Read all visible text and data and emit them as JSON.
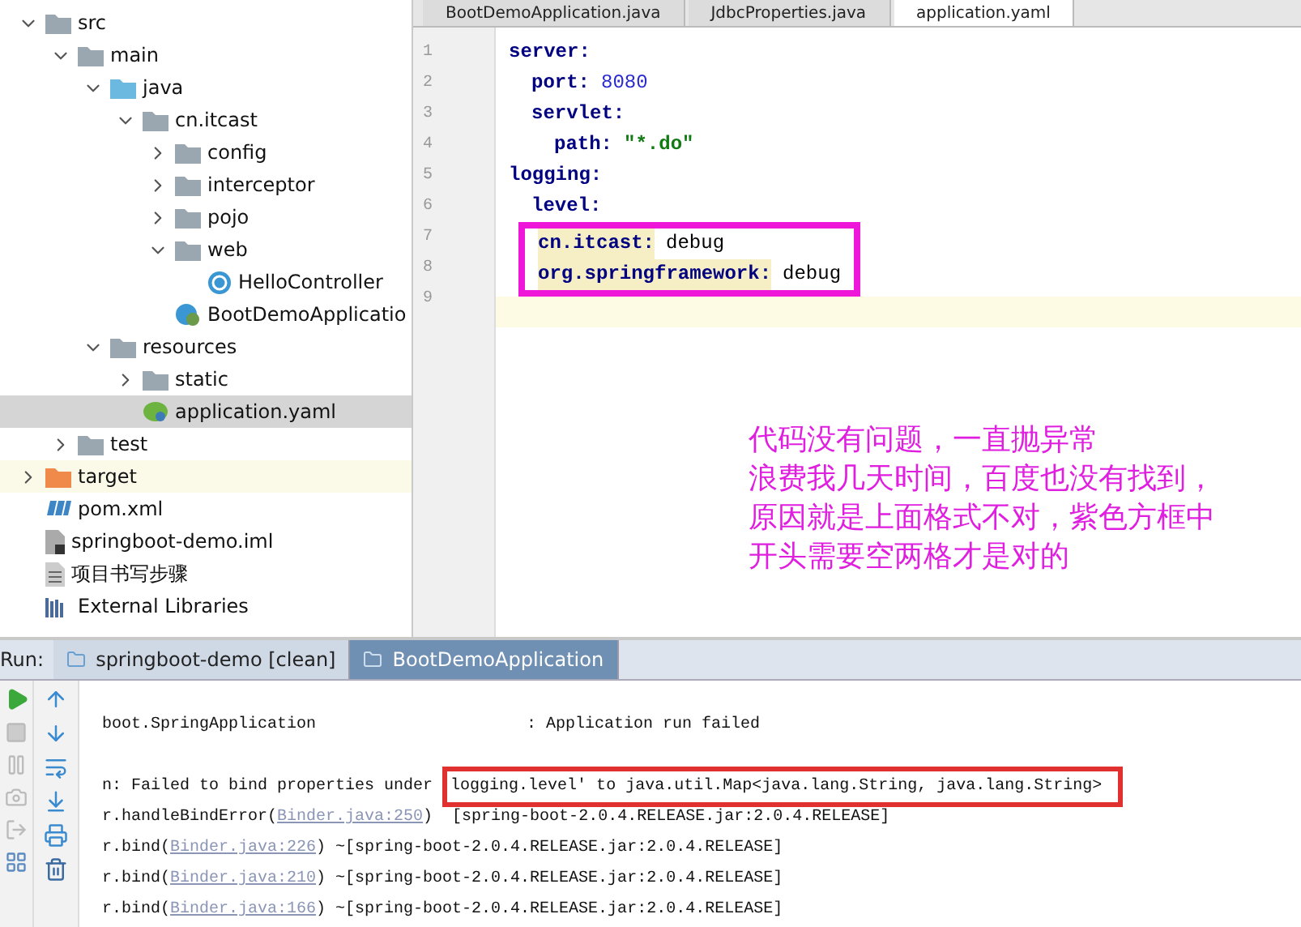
{
  "project_tree": [
    {
      "label": "src",
      "kind": "folder",
      "expanded": true,
      "selected": false,
      "children": [
        {
          "label": "main",
          "kind": "folder",
          "expanded": true,
          "selected": false,
          "children": [
            {
              "label": "java",
              "kind": "source-folder",
              "expanded": true,
              "selected": false,
              "children": [
                {
                  "label": "cn.itcast",
                  "kind": "package",
                  "expanded": true,
                  "selected": false,
                  "children": [
                    {
                      "label": "config",
                      "kind": "package",
                      "expanded": false,
                      "selected": false
                    },
                    {
                      "label": "interceptor",
                      "kind": "package",
                      "expanded": false,
                      "selected": false
                    },
                    {
                      "label": "pojo",
                      "kind": "package",
                      "expanded": false,
                      "selected": false
                    },
                    {
                      "label": "web",
                      "kind": "package",
                      "expanded": true,
                      "selected": false,
                      "children": [
                        {
                          "label": "HelloController",
                          "kind": "class",
                          "selected": false
                        }
                      ]
                    },
                    {
                      "label": "BootDemoApplicatio",
                      "kind": "spring-class",
                      "selected": false
                    }
                  ]
                }
              ]
            },
            {
              "label": "resources",
              "kind": "resources-folder",
              "expanded": true,
              "selected": false,
              "children": [
                {
                  "label": "static",
                  "kind": "package",
                  "expanded": false,
                  "selected": false
                },
                {
                  "label": "application.yaml",
                  "kind": "yaml",
                  "selected": true
                }
              ]
            }
          ]
        },
        {
          "label": "test",
          "kind": "folder",
          "expanded": false,
          "selected": false
        }
      ]
    },
    {
      "label": "target",
      "kind": "excluded-folder",
      "expanded": false,
      "selected": false
    },
    {
      "label": "pom.xml",
      "kind": "maven",
      "selected": false
    },
    {
      "label": "springboot-demo.iml",
      "kind": "iml",
      "selected": false
    },
    {
      "label": "项目书写步骤",
      "kind": "text",
      "selected": false
    },
    {
      "label": "External Libraries",
      "kind": "libraries",
      "selected": false
    }
  ],
  "editor_tabs": [
    {
      "label": "BootDemoApplication.java",
      "selected": false
    },
    {
      "label": "JdbcProperties.java",
      "selected": false
    },
    {
      "label": "application.yaml",
      "selected": true
    }
  ],
  "line_numbers": [
    "1",
    "2",
    "3",
    "4",
    "5",
    "6",
    "7",
    "8",
    "9"
  ],
  "yaml": [
    {
      "key": "server:",
      "children": [
        {
          "key": "port:",
          "value": "8080",
          "kind": "number"
        },
        {
          "key": "servlet:",
          "children": [
            {
              "key": "path:",
              "value": "\"*.do\"",
              "kind": "string"
            }
          ]
        }
      ]
    },
    {
      "key": "logging:",
      "children": [
        {
          "key": "level:",
          "boxed": true,
          "children": [
            {
              "key": "cn.itcast:",
              "value": "debug",
              "kind": "plain"
            },
            {
              "key": "org.springframework:",
              "value": "debug",
              "kind": "plain"
            }
          ]
        }
      ]
    }
  ],
  "annotation": [
    "代码没有问题，一直抛异常",
    "浪费我几天时间，百度也没有找到，",
    "原因就是上面格式不对，紫色方框中",
    "开头需要空两格才是对的"
  ],
  "run_panel": {
    "label": "Run:",
    "tabs": [
      {
        "label": "springboot-demo [clean]",
        "selected": false
      },
      {
        "label": "BootDemoApplication",
        "selected": true
      }
    ]
  },
  "console": [
    {
      "parts": [
        {
          "text": "boot.SpringApplication"
        },
        {
          "text": ": Application run failed",
          "kind": "gap"
        }
      ]
    },
    {
      "parts": [
        {
          "text": "n: Failed to bind properties under "
        },
        {
          "text": "logging.level' to java.util.Map<java.lang.String, java.lang.String>",
          "kind": "boxed"
        }
      ]
    },
    {
      "parts": [
        {
          "text": "r.handleBindError("
        },
        {
          "text": "Binder.java:250",
          "kind": "link"
        },
        {
          "text": ")  [spring-boot-2.0.4.RELEASE.jar:2.0.4.RELEASE]"
        }
      ]
    },
    {
      "parts": [
        {
          "text": "r.bind("
        },
        {
          "text": "Binder.java:226",
          "kind": "link"
        },
        {
          "text": ") ~[spring-boot-2.0.4.RELEASE.jar:2.0.4.RELEASE]"
        }
      ]
    },
    {
      "parts": [
        {
          "text": "r.bind("
        },
        {
          "text": "Binder.java:210",
          "kind": "link"
        },
        {
          "text": ") ~[spring-boot-2.0.4.RELEASE.jar:2.0.4.RELEASE]"
        }
      ]
    },
    {
      "parts": [
        {
          "text": "r.bind("
        },
        {
          "text": "Binder.java:166",
          "kind": "link"
        },
        {
          "text": ") ~[spring-boot-2.0.4.RELEASE.jar:2.0.4.RELEASE]"
        }
      ]
    }
  ]
}
